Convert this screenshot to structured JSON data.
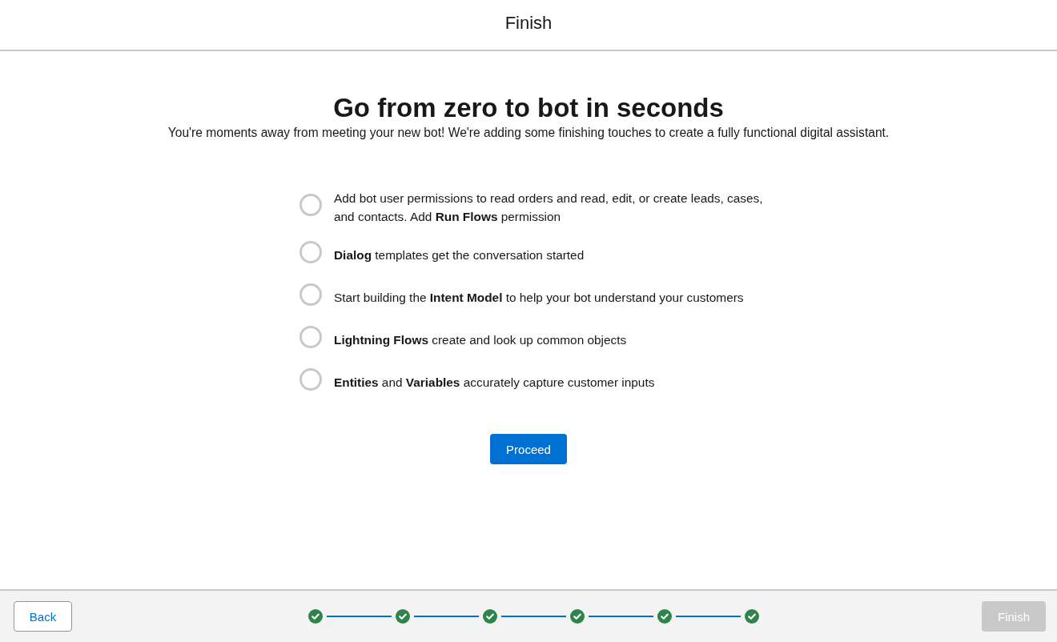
{
  "header": {
    "title": "Finish"
  },
  "intro": {
    "heading": "Go from zero to bot in seconds",
    "subtitle": "You're moments away from meeting your new bot! We're adding some finishing touches to create a fully functional digital assistant."
  },
  "tasks": [
    {
      "text": "Add bot user permissions to read orders and read, edit, or create leads, cases, and contacts. Add **Run Flows** permission",
      "done": false
    },
    {
      "text": "**Dialog** templates get the conversation started",
      "done": false
    },
    {
      "text": "Start building the **Intent Model** to help your bot understand your customers",
      "done": false
    },
    {
      "text": "**Lightning Flows** create and look up common objects",
      "done": false
    },
    {
      "text": "**Entities** and **Variables** accurately capture customer inputs",
      "done": false
    }
  ],
  "proceed_button": {
    "label": "Proceed"
  },
  "footer": {
    "back_button": {
      "label": "Back"
    },
    "steps": [
      {
        "completed": true
      },
      {
        "completed": true
      },
      {
        "completed": true
      },
      {
        "completed": true
      },
      {
        "completed": true
      },
      {
        "completed": true
      }
    ],
    "finish_button": {
      "label": "Finish",
      "disabled": true
    }
  }
}
